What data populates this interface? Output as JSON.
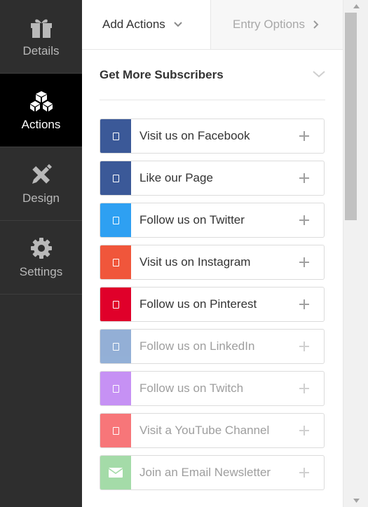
{
  "sidebar": {
    "items": [
      {
        "label": "Details",
        "icon": "gift-icon",
        "active": false
      },
      {
        "label": "Actions",
        "icon": "cubes-icon",
        "active": true
      },
      {
        "label": "Design",
        "icon": "pencil-ruler-icon",
        "active": false
      },
      {
        "label": "Settings",
        "icon": "gear-icon",
        "active": false
      }
    ]
  },
  "tabs": {
    "add_actions": "Add Actions",
    "entry_options": "Entry Options"
  },
  "section": {
    "title": "Get More Subscribers"
  },
  "actions": [
    {
      "label": "Visit us on Facebook",
      "color": "#3b5998",
      "icon": "facebook-icon",
      "enabled": true
    },
    {
      "label": "Like our Page",
      "color": "#3b5998",
      "icon": "facebook-like-icon",
      "enabled": true
    },
    {
      "label": "Follow us on Twitter",
      "color": "#2ea0f2",
      "icon": "twitter-icon",
      "enabled": true
    },
    {
      "label": "Visit us on Instagram",
      "color": "#f0563b",
      "icon": "instagram-icon",
      "enabled": true
    },
    {
      "label": "Follow us on Pinterest",
      "color": "#e0002a",
      "icon": "pinterest-icon",
      "enabled": true
    },
    {
      "label": "Follow us on LinkedIn",
      "color": "#6f95c9",
      "icon": "linkedin-icon",
      "enabled": false
    },
    {
      "label": "Follow us on Twitch",
      "color": "#b36cf0",
      "icon": "twitch-icon",
      "enabled": false
    },
    {
      "label": "Visit a YouTube Channel",
      "color": "#f4484c",
      "icon": "youtube-icon",
      "enabled": false
    },
    {
      "label": "Join an Email Newsletter",
      "color": "#86cf8b",
      "icon": "envelope-icon",
      "enabled": false
    }
  ]
}
